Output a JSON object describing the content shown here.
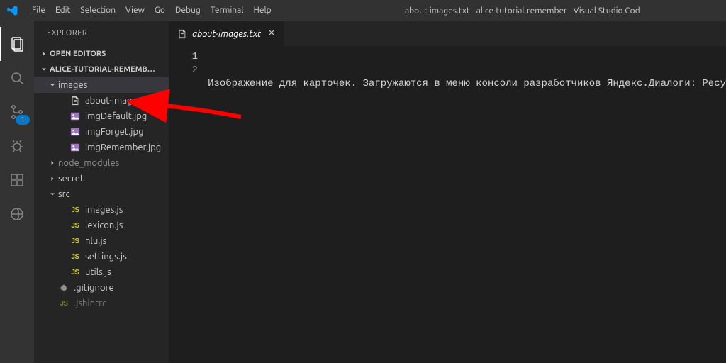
{
  "window_title": "about-images.txt - alice-tutorial-remember - Visual Studio Cod",
  "menu": [
    "File",
    "Edit",
    "Selection",
    "View",
    "Go",
    "Debug",
    "Terminal",
    "Help"
  ],
  "activity": {
    "scm_badge": "1"
  },
  "sidebar": {
    "title": "EXPLORER",
    "open_editors": "OPEN EDITORS",
    "project": "ALICE-TUTORIAL-REMEMB…",
    "images_folder": "images",
    "files": {
      "about": "about-images.txt",
      "imgDefault": "imgDefault.jpg",
      "imgForget": "imgForget.jpg",
      "imgRemember": "imgRemember.jpg"
    },
    "node_modules": "node_modules",
    "secret": "secret",
    "src": "src",
    "src_files": {
      "images": "images.js",
      "lexicon": "lexicon.js",
      "nlu": "nlu.js",
      "settings": "settings.js",
      "utils": "utils.js"
    },
    "gitignore": ".gitignore",
    "jshintrc_partial": ".jshintrc"
  },
  "tab": {
    "label": "about-images.txt"
  },
  "editor": {
    "line_numbers": [
      "1",
      "2"
    ],
    "lines": [
      "Изображение для карточек. Загружаются в меню консоли разработчиков Яндекс.Диалоги: Ресу",
      ""
    ]
  }
}
